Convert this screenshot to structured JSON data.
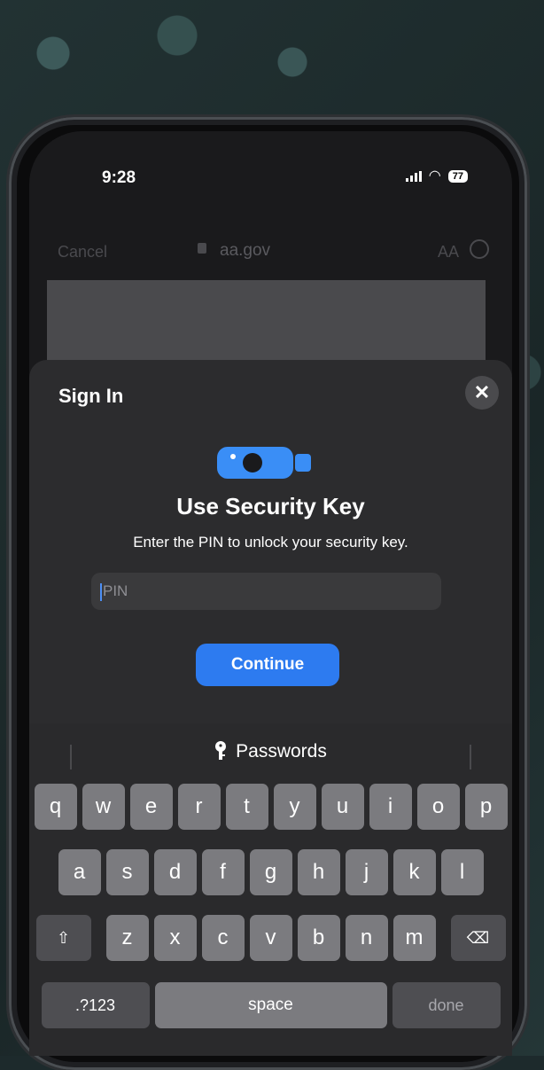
{
  "status": {
    "time": "9:28",
    "battery": "77"
  },
  "browser": {
    "cancel_label": "Cancel",
    "url": "aa.gov",
    "aa_label": "AA"
  },
  "sheet": {
    "title": "Sign In",
    "close_label": "✕",
    "heading": "Use Security Key",
    "subtitle": "Enter the PIN to unlock your security key.",
    "pin_placeholder": "PIN",
    "continue_label": "Continue"
  },
  "keyboard": {
    "toolbar_label": "Passwords",
    "row1": [
      "q",
      "w",
      "e",
      "r",
      "t",
      "y",
      "u",
      "i",
      "o",
      "p"
    ],
    "row2": [
      "a",
      "s",
      "d",
      "f",
      "g",
      "h",
      "j",
      "k",
      "l"
    ],
    "row3": [
      "z",
      "x",
      "c",
      "v",
      "b",
      "n",
      "m"
    ],
    "shift_label": "⇧",
    "delete_label": "⌫",
    "numbers_label": ".?123",
    "space_label": "space",
    "done_label": "done"
  },
  "colors": {
    "accent": "#2d7bf0",
    "sheet_bg": "#2c2c2e",
    "key_bg": "#7b7b7f"
  },
  "icons": [
    "security-key-icon",
    "close-icon",
    "key-icon",
    "shift-icon",
    "delete-icon",
    "lock-icon",
    "wifi-icon",
    "battery-icon"
  ]
}
